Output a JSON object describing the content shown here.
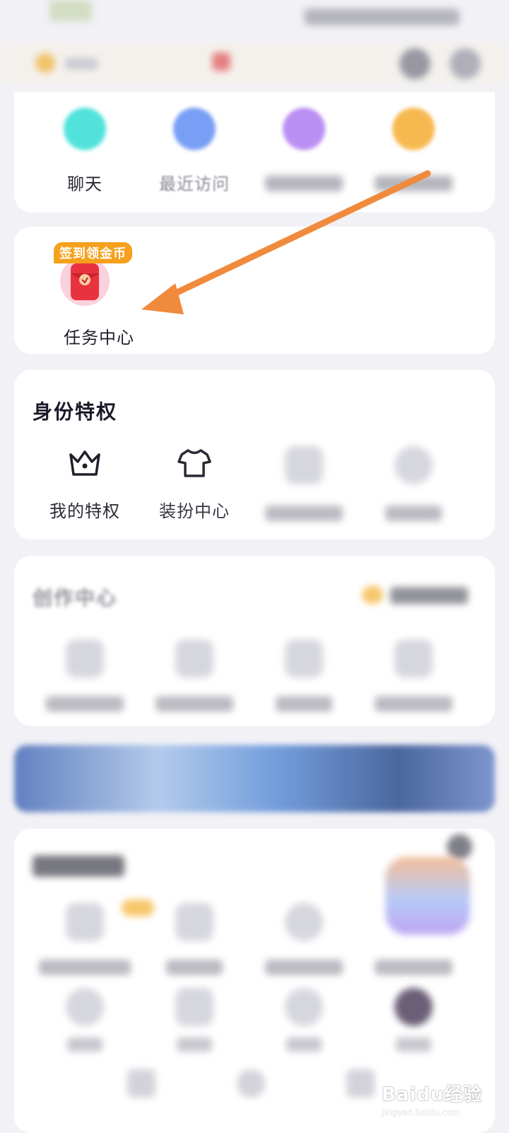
{
  "task_card": {
    "badge": "签到领金币",
    "label": "任务中心"
  },
  "quick_row": {
    "chat_label": "聊天",
    "recent_label": "最近访问"
  },
  "privileges": {
    "title": "身份特权",
    "my_privileges_label": "我的特权",
    "dress_up_label": "装扮中心"
  },
  "creation": {
    "title": "创作中心"
  },
  "watermark": {
    "text": "Baidu经验",
    "url": "jingyan.baidu.com"
  }
}
